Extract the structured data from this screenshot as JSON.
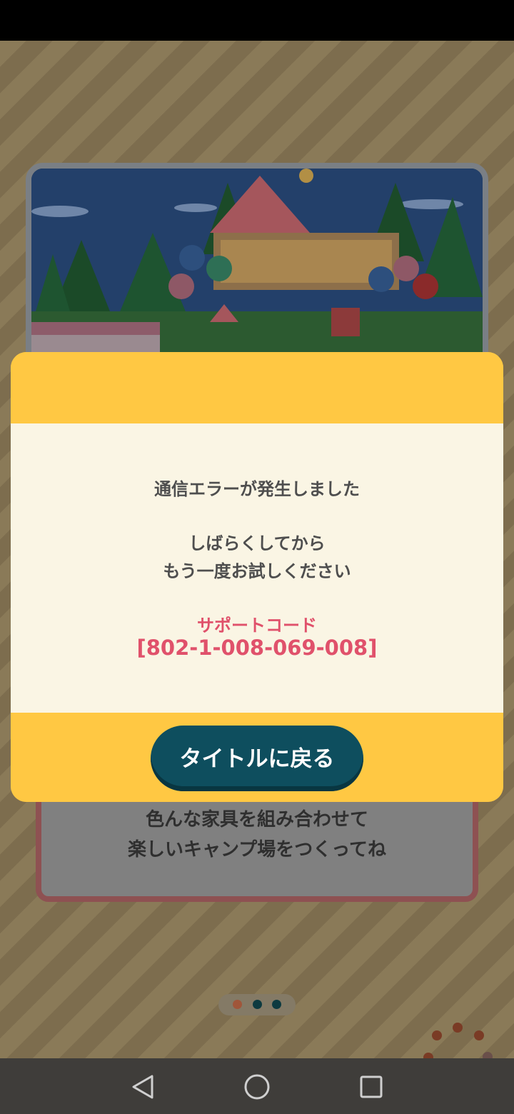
{
  "dialog": {
    "title_line": "通信エラーが発生しました",
    "message_line1": "しばらくしてから",
    "message_line2": "もう一度お試しください",
    "support_label": "サポートコード",
    "support_code": "[802-1-008-069-008]",
    "button_label": "タイトルに戻る"
  },
  "background_card": {
    "line1": "色んな家具を組み合わせて",
    "line2": "楽しいキャンプ場をつくってね"
  },
  "page_indicator": {
    "count": 3,
    "active_index": 0
  },
  "colors": {
    "dialog_yellow": "#ffc843",
    "dialog_body": "#faf5e4",
    "button_teal": "#0e4e5e",
    "support_pink": "#e0516b"
  },
  "icons": {
    "nav_back": "triangle-back-icon",
    "nav_home": "circle-home-icon",
    "nav_recents": "square-recents-icon",
    "loading": "loading-spinner-icon"
  }
}
